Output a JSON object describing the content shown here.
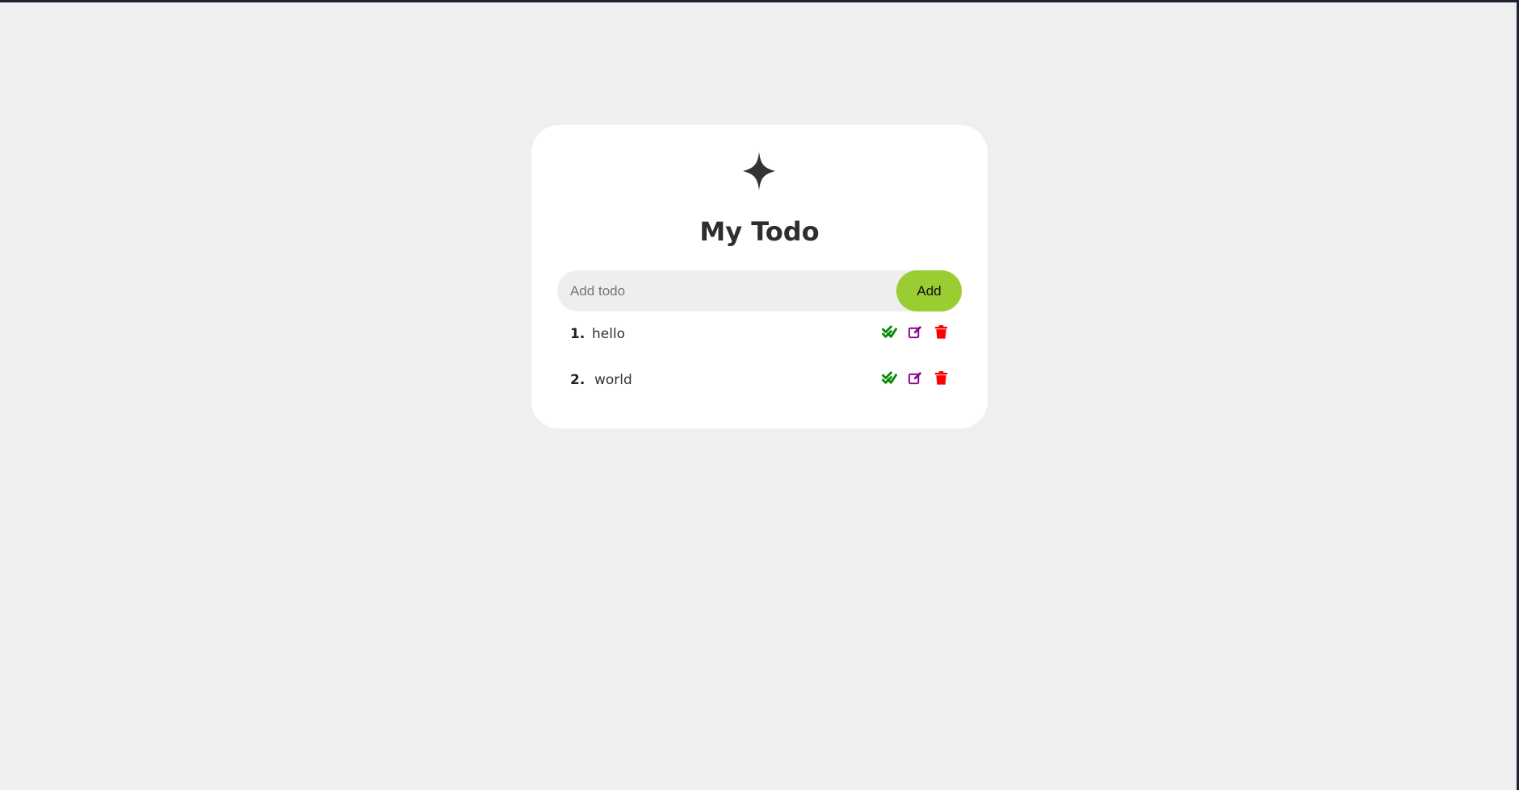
{
  "app": {
    "title": "My Todo"
  },
  "colors": {
    "background": "#efefef",
    "card": "#ffffff",
    "accent": "#9acd32",
    "complete": "#0a8a0a",
    "edit": "#8b008b",
    "delete": "#ff0000",
    "text": "#2e2e2e"
  },
  "form": {
    "input_value": "",
    "input_placeholder": "Add todo",
    "add_label": "Add"
  },
  "todos": [
    {
      "number": "1.",
      "text": "hello",
      "actions": [
        "check-double-icon",
        "edit-icon",
        "trash-icon"
      ]
    },
    {
      "number": "2.",
      "text": "world",
      "actions": [
        "check-double-icon",
        "edit-icon",
        "trash-icon"
      ]
    }
  ]
}
